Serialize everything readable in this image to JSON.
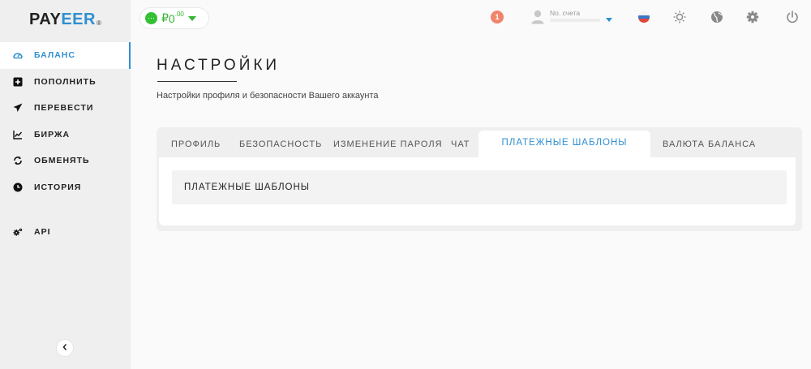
{
  "logo": {
    "part1": "PAY",
    "part2": "EER",
    "reg": "®"
  },
  "sidebar": {
    "items": [
      {
        "label": "БАЛАНС",
        "icon": "dashboard-icon",
        "active": true
      },
      {
        "label": "ПОПОЛНИТЬ",
        "icon": "plus-square-icon",
        "active": false
      },
      {
        "label": "ПЕРЕВЕСТИ",
        "icon": "paper-plane-icon",
        "active": false
      },
      {
        "label": "БИРЖА",
        "icon": "line-chart-icon",
        "active": false
      },
      {
        "label": "ОБМЕНЯТЬ",
        "icon": "exchange-icon",
        "active": false
      },
      {
        "label": "ИСТОРИЯ",
        "icon": "clock-icon",
        "active": false
      }
    ],
    "api_label": "API",
    "collapse_icon": "chevron-left-icon"
  },
  "header": {
    "balance": {
      "currency": "₽",
      "integer": "0",
      "decimal": ".00",
      "icon_text": "···"
    },
    "notifications": {
      "count": "1"
    },
    "account": {
      "label": "No. счета"
    },
    "icons": [
      "sun-icon",
      "globe-icon",
      "gear-icon",
      "power-icon"
    ]
  },
  "page": {
    "title": "НАСТРОЙКИ",
    "subtitle": "Настройки профиля и безопасности Вашего аккаунта"
  },
  "tabs": [
    {
      "label": "ПРОФИЛЬ"
    },
    {
      "label": "БЕЗОПАСНОСТЬ"
    },
    {
      "label": "ИЗМЕНЕНИЕ ПАРОЛЯ"
    },
    {
      "label": "ЧАТ"
    },
    {
      "label": "ПЛАТЕЖНЫЕ ШАБЛОНЫ",
      "active": true
    },
    {
      "label": "ВАЛЮТА БАЛАНСА"
    }
  ],
  "panel": {
    "section_title": "ПЛАТЕЖНЫЕ ШАБЛОНЫ"
  },
  "colors": {
    "accent": "#2f8fd0",
    "balance_green": "#33b533",
    "notification": "#f0846b"
  }
}
